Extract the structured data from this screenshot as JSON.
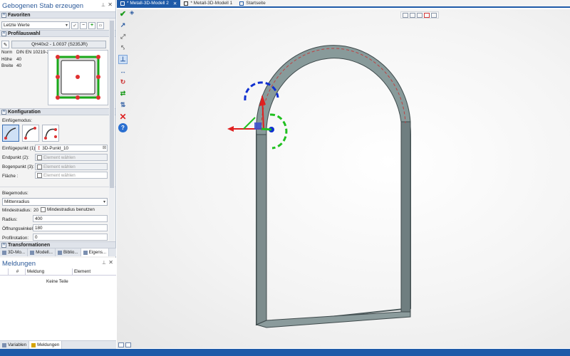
{
  "panel": {
    "title": "Gebogenen Stab erzeugen",
    "favoriten": {
      "heading": "Favoriten",
      "selected": "Letzte Werte"
    },
    "profil": {
      "heading": "Profilauswahl",
      "profile_name": "QH40x2 - 1.0037 (S235JR)",
      "norm_label": "Norm",
      "norm_value": "DIN EN 10219-2",
      "hoehe_label": "Höhe",
      "hoehe_value": "40",
      "breite_label": "Breite",
      "breite_value": "40"
    },
    "konfiguration": {
      "heading": "Konfiguration",
      "einfuegemodus_label": "Einfügemodus:",
      "einfuegepunkt_label": "Einfügepunkt (1):",
      "einfuegepunkt_value": "3D-Punkt_10",
      "endpunkt_label": "Endpunkt (2):",
      "endpunkt_placeholder": "Element wählen",
      "bogenpunkt_label": "Bogenpunkt (3):",
      "bogenpunkt_placeholder": "Element wählen",
      "flaeche_label": "Fläche :",
      "flaeche_placeholder": "Element wählen",
      "biegemodus_label": "Biegemodus:",
      "biegemodus_value": "Mittenradius",
      "mindestradius_label": "Mindestradius:",
      "mindestradius_value": "20",
      "mindestradius_checkbox": "Mindestradius benutzen",
      "radius_label": "Radius:",
      "radius_value": "400",
      "oeffnungswinkel_label": "Öffnungswinkel:",
      "oeffnungswinkel_value": "180",
      "profilrotation_label": "Profilrotation:",
      "profilrotation_value": "0"
    },
    "transformationen": {
      "heading": "Transformationen"
    },
    "tabs": [
      "3D-Mo...",
      "Modell...",
      "Biblio...",
      "Eigens..."
    ]
  },
  "meldungen": {
    "title": "Meldungen",
    "columns": [
      "#",
      "Meldung",
      "Element"
    ],
    "empty_text": "Keine Teile",
    "tabs": [
      "Variablen",
      "Meldungen"
    ]
  },
  "document_tabs": [
    {
      "label": "* Metall-3D-Modell 2",
      "active": true
    },
    {
      "label": "* Metall-3D-Modell 1",
      "active": false
    },
    {
      "label": "Startseite",
      "active": false
    }
  ],
  "colors": {
    "accent": "#1e5aa8",
    "frame_top": "#8a9a9a",
    "frame_side": "#6f7f80",
    "axis_x": "#e02020",
    "axis_y": "#20c020",
    "axis_z": "#1030d0"
  },
  "icons": [
    "pin-icon",
    "close-icon",
    "save-favorite-icon",
    "checkmark-icon",
    "minus-icon",
    "plus-icon",
    "profile-picker-icon",
    "insert-mode-icon",
    "confirm-icon",
    "cancel-icon",
    "help-icon"
  ]
}
